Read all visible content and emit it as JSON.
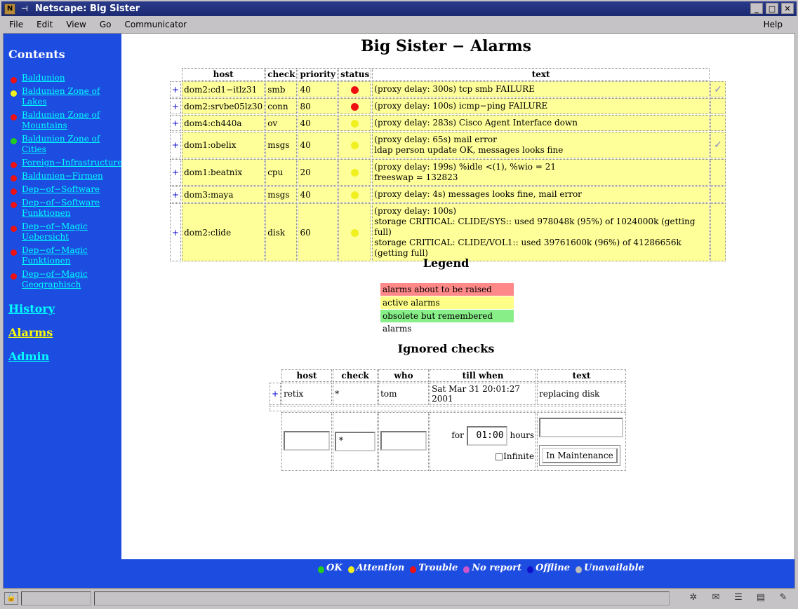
{
  "window": {
    "title": "Netscape: Big Sister",
    "buttons": [
      "_",
      "□",
      "✕"
    ]
  },
  "menu": {
    "file": "File",
    "edit": "Edit",
    "view": "View",
    "go": "Go",
    "communicator": "Communicator",
    "help": "Help"
  },
  "sidebar": {
    "title": "Contents",
    "items": [
      {
        "label": "Baldunien",
        "status": "red"
      },
      {
        "label": "Baldunien Zone of Lakes",
        "status": "yellow"
      },
      {
        "label": "Baldunien Zone of Mountains",
        "status": "red"
      },
      {
        "label": "Baldunien Zone of Cities",
        "status": "green"
      },
      {
        "label": "Foreign−Infrastructure",
        "status": "red"
      },
      {
        "label": "Baldunien−Firmen",
        "status": "red"
      },
      {
        "label": "Dep−of−Software",
        "status": "red"
      },
      {
        "label": "Dep−of−Software Funktionen",
        "status": "red"
      },
      {
        "label": "Dep−of−Magic Uebersicht",
        "status": "red"
      },
      {
        "label": "Dep−of−Magic Funktionen",
        "status": "red"
      },
      {
        "label": "Dep−of−Magic Geographisch",
        "status": "red"
      }
    ],
    "history": "History",
    "alarms": "Alarms",
    "admin": "Admin"
  },
  "page": {
    "title": "Big Sister − Alarms"
  },
  "alarms": {
    "headers": {
      "host": "host",
      "check": "check",
      "priority": "priority",
      "status": "status",
      "text": "text"
    },
    "rows": [
      {
        "plus": "+",
        "host": "dom2:cd1−itlz31",
        "check": "smb",
        "priority": "40",
        "status": "red",
        "text": [
          "(proxy delay: 300s) tcp smb FAILURE"
        ],
        "ack": "✓"
      },
      {
        "plus": "+",
        "host": "dom2:srvbe05lz30",
        "check": "conn",
        "priority": "80",
        "status": "red",
        "text": [
          "(proxy delay: 100s) icmp−ping FAILURE"
        ],
        "ack": ""
      },
      {
        "plus": "+",
        "host": "dom4:ch440a",
        "check": "ov",
        "priority": "40",
        "status": "yellow",
        "text": [
          "(proxy delay: 283s) Cisco Agent Interface down"
        ],
        "ack": ""
      },
      {
        "plus": "+",
        "host": "dom1:obelix",
        "check": "msgs",
        "priority": "40",
        "status": "yellow",
        "text": [
          "(proxy delay: 65s) mail error",
          "ldap person update OK, messages looks fine"
        ],
        "ack": "✓"
      },
      {
        "plus": "+",
        "host": "dom1:beatnix",
        "check": "cpu",
        "priority": "20",
        "status": "yellow",
        "text": [
          "(proxy delay: 199s) %idle <(1), %wio = 21",
          "freeswap = 132823"
        ],
        "ack": ""
      },
      {
        "plus": "+",
        "host": "dom3:maya",
        "check": "msgs",
        "priority": "40",
        "status": "yellow",
        "text": [
          "(proxy delay: 4s) messages looks fine, mail error"
        ],
        "ack": ""
      },
      {
        "plus": "+",
        "host": "dom2:clide",
        "check": "disk",
        "priority": "60",
        "status": "yellow",
        "text": [
          "(proxy delay: 100s)",
          "storage CRITICAL: CLIDE/SYS:: used 978048k (95%) of 1024000k (getting full)",
          "storage CRITICAL: CLIDE/VOL1:: used 39761600k (96%) of 41286656k (getting full)"
        ],
        "ack": ""
      }
    ]
  },
  "legend": {
    "title": "Legend",
    "items": [
      {
        "label": "alarms about to be raised",
        "color": "#ff8888"
      },
      {
        "label": "active alarms",
        "color": "#ffff88"
      },
      {
        "label": "obsolete but remembered alarms",
        "color": "#88ee88"
      }
    ]
  },
  "ignored": {
    "title": "Ignored checks",
    "headers": {
      "host": "host",
      "check": "check",
      "who": "who",
      "till": "till when",
      "text": "text"
    },
    "rows": [
      {
        "plus": "+",
        "host": "retix",
        "check": "*",
        "who": "tom",
        "till": "Sat Mar 31 20:01:27 2001",
        "text": "replacing disk"
      }
    ],
    "form": {
      "host_value": "",
      "check_value": "*",
      "who_value": "",
      "for_label": "for",
      "duration_value": "01:00",
      "hours_label": "hours",
      "text_value": "",
      "infinite_label": "Infinite",
      "submit_label": "In Maintenance"
    }
  },
  "footer": {
    "legend": [
      {
        "label": "OK",
        "color": "green"
      },
      {
        "label": "Attention",
        "color": "yellow"
      },
      {
        "label": "Trouble",
        "color": "red"
      },
      {
        "label": "No report",
        "color": "purple"
      },
      {
        "label": "Offline",
        "color": "blue"
      },
      {
        "label": "Unavailable",
        "color": "gray"
      }
    ]
  }
}
